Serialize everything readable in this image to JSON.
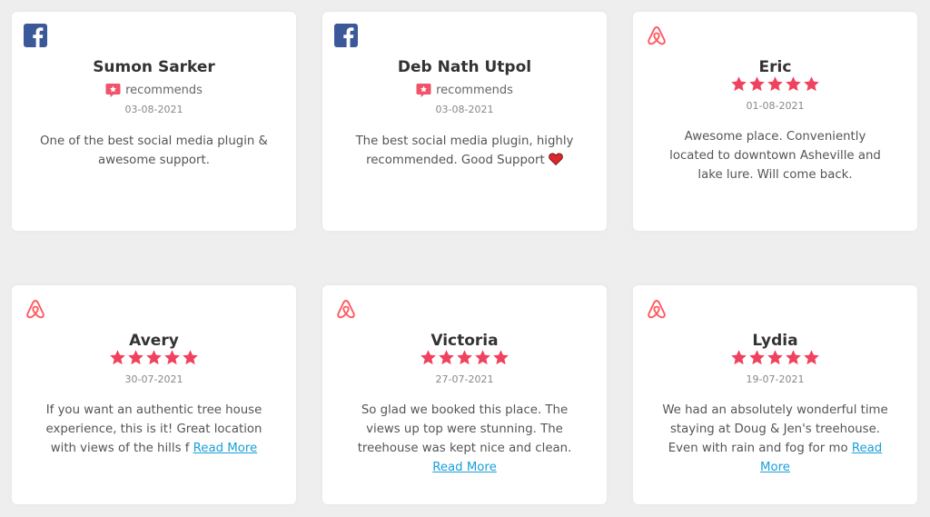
{
  "reviews": [
    {
      "platform": "facebook",
      "icon": "facebook-icon",
      "name": "Sumon Sarker",
      "recommend_label": "recommends",
      "date": "03-08-2021",
      "text": "One of the best social media plugin & awesome support."
    },
    {
      "platform": "facebook",
      "icon": "facebook-icon",
      "name": "Deb Nath Utpol",
      "recommend_label": "recommends",
      "date": "03-08-2021",
      "text": "The best social media plugin, highly recommended. Good Support"
    },
    {
      "platform": "airbnb",
      "icon": "airbnb-icon",
      "name": "Eric",
      "rating": 5,
      "date": "01-08-2021",
      "text": "Awesome place. Conveniently located to downtown Asheville and lake lure. Will come back."
    },
    {
      "platform": "airbnb",
      "icon": "airbnb-icon",
      "name": "Avery",
      "rating": 5,
      "date": "30-07-2021",
      "text": "If you want an authentic tree house experience, this is it! Great location with views of the hills f",
      "read_more": "Read More"
    },
    {
      "platform": "airbnb",
      "icon": "airbnb-icon",
      "name": "Victoria",
      "rating": 5,
      "date": "27-07-2021",
      "text": "So glad we booked this place. The views up top were stunning. The treehouse was kept nice and clean.",
      "read_more": "Read More"
    },
    {
      "platform": "airbnb",
      "icon": "airbnb-icon",
      "name": "Lydia",
      "rating": 5,
      "date": "19-07-2021",
      "text": "We had an absolutely wonderful time staying at Doug & Jen's treehouse. Even with rain and fog for mo",
      "read_more": "Read More"
    }
  ],
  "colors": {
    "facebook": "#3b5998",
    "airbnb": "#ff5a5f",
    "star": "#f0425e",
    "recommend_badge": "#f0546a",
    "heart": "#e0242c",
    "link": "#1a9fd8"
  }
}
